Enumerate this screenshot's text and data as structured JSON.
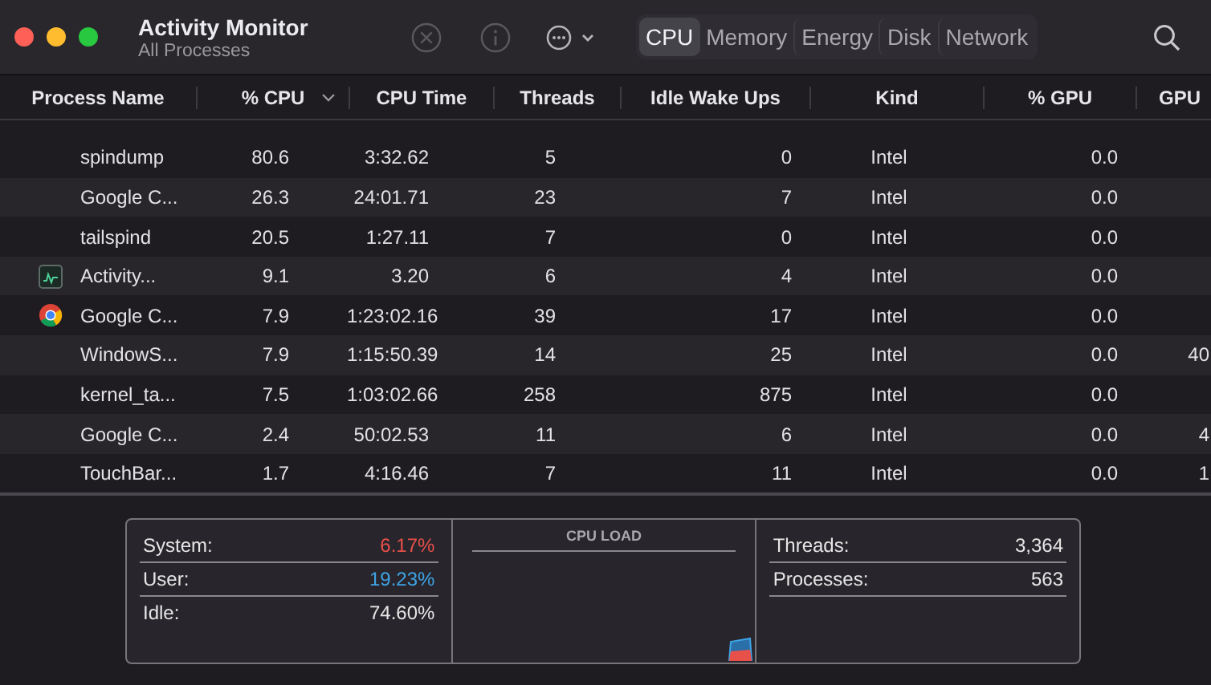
{
  "window": {
    "title": "Activity Monitor",
    "subtitle": "All Processes"
  },
  "tabs": [
    {
      "label": "CPU",
      "selected": true
    },
    {
      "label": "Memory",
      "selected": false
    },
    {
      "label": "Energy",
      "selected": false
    },
    {
      "label": "Disk",
      "selected": false
    },
    {
      "label": "Network",
      "selected": false
    }
  ],
  "table": {
    "columns": [
      {
        "label": "Process Name",
        "sorted": false
      },
      {
        "label": "% CPU",
        "sorted": true
      },
      {
        "label": "CPU Time",
        "sorted": false
      },
      {
        "label": "Threads",
        "sorted": false
      },
      {
        "label": "Idle Wake Ups",
        "sorted": false
      },
      {
        "label": "Kind",
        "sorted": false
      },
      {
        "label": "% GPU",
        "sorted": false
      },
      {
        "label": "GPU",
        "sorted": false
      }
    ],
    "rows": [
      {
        "kind": "plain",
        "cells": [
          "spindump",
          "80.6",
          "3:32.62",
          "5",
          "0",
          "Intel",
          "0.0",
          ""
        ]
      },
      {
        "kind": "plain",
        "cells": [
          "Google C...",
          "26.3",
          "24:01.71",
          "23",
          "7",
          "Intel",
          "0.0",
          ""
        ]
      },
      {
        "kind": "plain",
        "cells": [
          "tailspind",
          "20.5",
          "1:27.11",
          "7",
          "0",
          "Intel",
          "0.0",
          ""
        ]
      },
      {
        "kind": "monitor",
        "cells": [
          "Activity...",
          "9.1",
          "3.20",
          "6",
          "4",
          "Intel",
          "0.0",
          ""
        ]
      },
      {
        "kind": "browser",
        "cells": [
          "Google C...",
          "7.9",
          "1:23:02.16",
          "39",
          "17",
          "Intel",
          "0.0",
          ""
        ]
      },
      {
        "kind": "plain",
        "cells": [
          "WindowS...",
          "7.9",
          "1:15:50.39",
          "14",
          "25",
          "Intel",
          "0.0",
          "40"
        ]
      },
      {
        "kind": "plain",
        "cells": [
          "kernel_ta...",
          "7.5",
          "1:03:02.66",
          "258",
          "875",
          "Intel",
          "0.0",
          ""
        ]
      },
      {
        "kind": "plain",
        "cells": [
          "Google C...",
          "2.4",
          "50:02.53",
          "11",
          "6",
          "Intel",
          "0.0",
          "4"
        ]
      },
      {
        "kind": "plain",
        "cells": [
          "TouchBar...",
          "1.7",
          "4:16.46",
          "7",
          "11",
          "Intel",
          "0.0",
          "1"
        ]
      }
    ]
  },
  "cpu_stats": [
    {
      "label": "System:",
      "value": "6.17%",
      "color": "#e8504a"
    },
    {
      "label": "User:",
      "value": "19.23%",
      "color": "#3fa4e6"
    },
    {
      "label": "Idle:",
      "value": "74.60%",
      "color": "#e6e6e6"
    }
  ],
  "cpu_load": {
    "title": "CPU LOAD"
  },
  "counts": [
    {
      "label": "Threads:",
      "value": "3,364"
    },
    {
      "label": "Processes:",
      "value": "563"
    }
  ]
}
